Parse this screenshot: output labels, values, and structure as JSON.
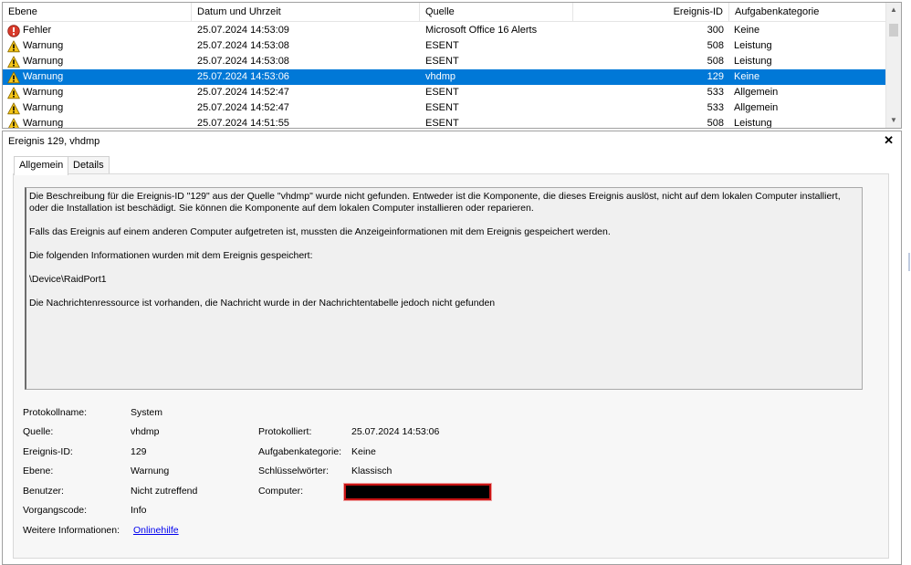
{
  "columns": {
    "level": "Ebene",
    "datetime": "Datum und Uhrzeit",
    "source": "Quelle",
    "event_id": "Ereignis-ID",
    "category": "Aufgabenkategorie"
  },
  "events": [
    {
      "level": "Fehler",
      "icon": "error-icon",
      "datetime": "25.07.2024 14:53:09",
      "source": "Microsoft Office 16 Alerts",
      "event_id": "300",
      "category": "Keine",
      "selected": false
    },
    {
      "level": "Warnung",
      "icon": "warning-icon",
      "datetime": "25.07.2024 14:53:08",
      "source": "ESENT",
      "event_id": "508",
      "category": "Leistung",
      "selected": false
    },
    {
      "level": "Warnung",
      "icon": "warning-icon",
      "datetime": "25.07.2024 14:53:08",
      "source": "ESENT",
      "event_id": "508",
      "category": "Leistung",
      "selected": false
    },
    {
      "level": "Warnung",
      "icon": "warning-icon",
      "datetime": "25.07.2024 14:53:06",
      "source": "vhdmp",
      "event_id": "129",
      "category": "Keine",
      "selected": true
    },
    {
      "level": "Warnung",
      "icon": "warning-icon",
      "datetime": "25.07.2024 14:52:47",
      "source": "ESENT",
      "event_id": "533",
      "category": "Allgemein",
      "selected": false
    },
    {
      "level": "Warnung",
      "icon": "warning-icon",
      "datetime": "25.07.2024 14:52:47",
      "source": "ESENT",
      "event_id": "533",
      "category": "Allgemein",
      "selected": false
    },
    {
      "level": "Warnung",
      "icon": "warning-icon",
      "datetime": "25.07.2024 14:51:55",
      "source": "ESENT",
      "event_id": "508",
      "category": "Leistung",
      "selected": false
    }
  ],
  "detail": {
    "title": "Ereignis 129, vhdmp",
    "tabs": [
      "Allgemein",
      "Details"
    ],
    "description": [
      "Die Beschreibung für die Ereignis-ID \"129\" aus der Quelle \"vhdmp\" wurde nicht gefunden. Entweder ist die Komponente, die dieses Ereignis auslöst, nicht auf dem lokalen Computer installiert, oder die Installation ist beschädigt. Sie können die Komponente auf dem lokalen Computer installieren oder reparieren.",
      "Falls das Ereignis auf einem anderen Computer aufgetreten ist, mussten die Anzeigeinformationen mit dem Ereignis gespeichert werden.",
      "Die folgenden Informationen wurden mit dem Ereignis gespeichert:",
      "\\Device\\RaidPort1",
      "Die Nachrichtenressource ist vorhanden, die Nachricht wurde in der Nachrichtentabelle jedoch nicht gefunden"
    ],
    "fields": {
      "log_name_label": "Protokollname:",
      "log_name": "System",
      "source_label": "Quelle:",
      "source": "vhdmp",
      "logged_label": "Protokolliert:",
      "logged": "25.07.2024 14:53:06",
      "event_id_label": "Ereignis-ID:",
      "event_id": "129",
      "task_category_label": "Aufgabenkategorie:",
      "task_category": "Keine",
      "level_label": "Ebene:",
      "level": "Warnung",
      "keywords_label": "Schlüsselwörter:",
      "keywords": "Klassisch",
      "user_label": "Benutzer:",
      "user": "Nicht zutreffend",
      "computer_label": "Computer:",
      "opcode_label": "Vorgangscode:",
      "opcode": "Info",
      "more_info_label": "Weitere Informationen:",
      "more_info_link": "Onlinehilfe"
    }
  },
  "colors": {
    "selection": "#0078d7",
    "redaction_border": "#c81414",
    "link": "#0000ee"
  }
}
